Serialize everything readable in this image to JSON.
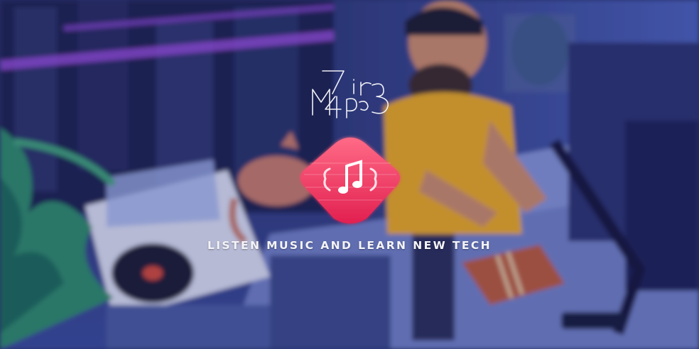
{
  "logo_text": "Mp3 7ir",
  "tagline": "LISTEN MUSIC AND LEARN NEW TECH",
  "colors": {
    "background": "#2a3470",
    "icon_gradient_top": "#ff5a78",
    "icon_gradient_bottom": "#e8264f",
    "shirt": "#e8a824",
    "accent_purple": "#8a4fd8"
  },
  "icons": {
    "app_icon": "music-note-icon",
    "logo": "mp3-logo-icon"
  }
}
